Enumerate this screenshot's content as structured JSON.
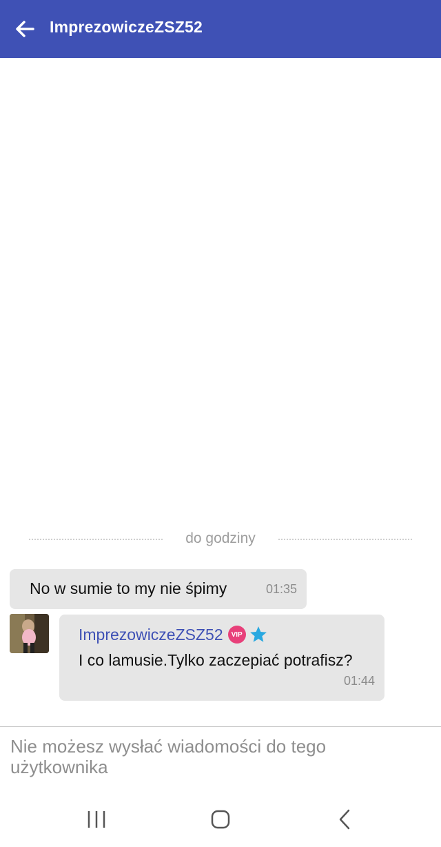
{
  "header": {
    "title": "ImprezowiczeZSZ52",
    "back_icon": "arrow-left-icon",
    "background_color": "#3f51b5"
  },
  "chat": {
    "divider_label": "do godziny",
    "messages": [
      {
        "direction": "outgoing",
        "text": "No w sumie to my nie śpimy",
        "time": "01:35"
      },
      {
        "direction": "incoming",
        "sender": "ImprezowiczeZSZ52",
        "badges": [
          "vip-badge",
          "star-icon"
        ],
        "vip_label": "VIP",
        "text": "I co lamusie.Tylko zaczepiać potrafisz?",
        "time": "01:44"
      }
    ]
  },
  "composer": {
    "disabled_note": "Nie możesz wysłać wiadomości do tego użytkownika"
  },
  "system_nav": {
    "icons": [
      "recent-apps-icon",
      "home-icon",
      "back-icon"
    ]
  },
  "colors": {
    "accent": "#3f51b5",
    "bubble": "#e6e6e6",
    "vip": "#e8407a",
    "star": "#29a8e0"
  }
}
